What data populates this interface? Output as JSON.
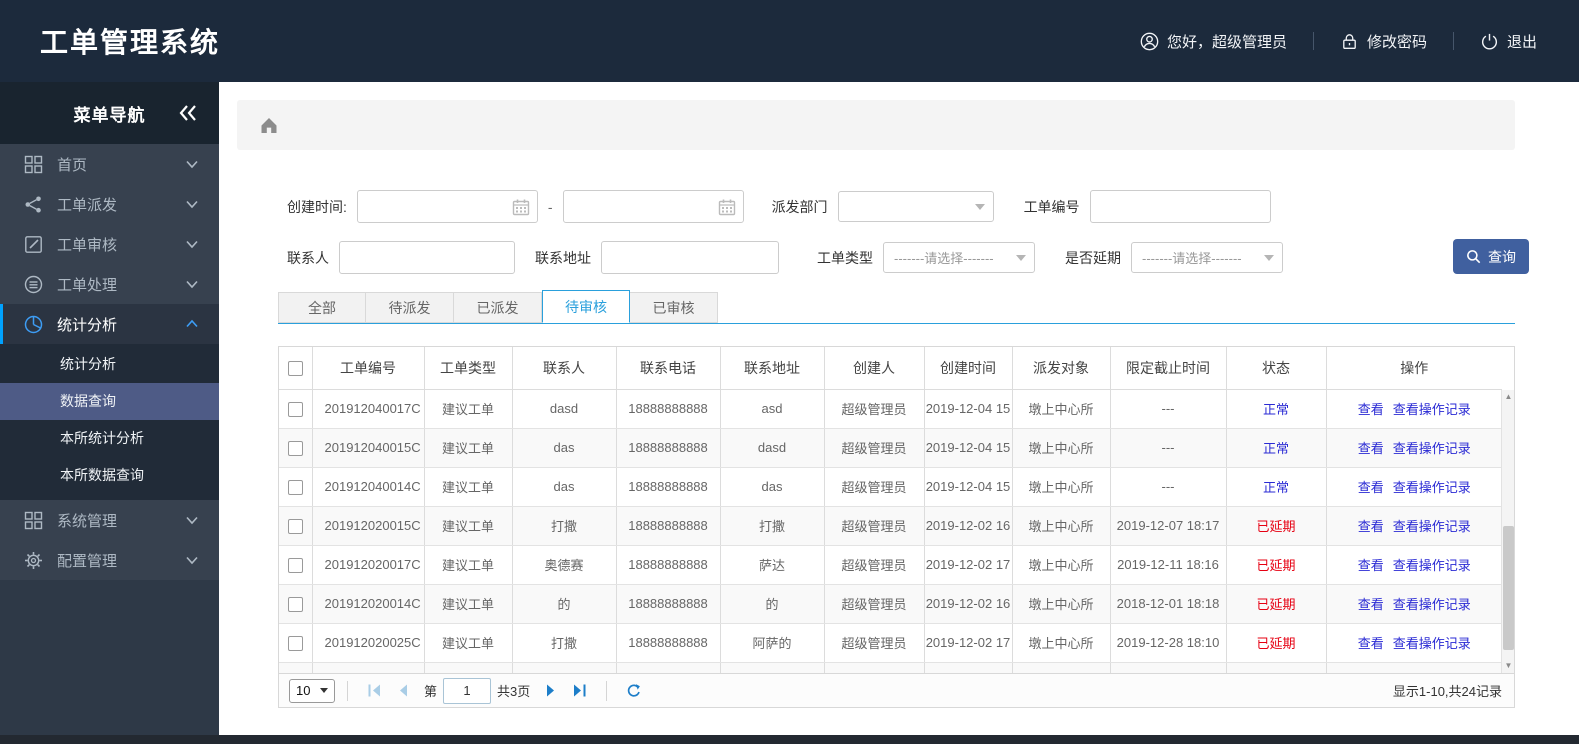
{
  "app": {
    "title": "工单管理系统"
  },
  "header": {
    "greeting": "您好，超级管理员",
    "change_password": "修改密码",
    "logout": "退出"
  },
  "sidebar": {
    "title": "菜单导航",
    "items": [
      {
        "label": "首页",
        "icon": "dashboard-icon"
      },
      {
        "label": "工单派发",
        "icon": "share-icon"
      },
      {
        "label": "工单审核",
        "icon": "edit-icon"
      },
      {
        "label": "工单处理",
        "icon": "database-icon"
      },
      {
        "label": "统计分析",
        "icon": "pie-chart-icon",
        "expanded": true
      },
      {
        "label": "系统管理",
        "icon": "grid-icon"
      },
      {
        "label": "配置管理",
        "icon": "gear-icon"
      }
    ],
    "subitems": [
      "统计分析",
      "数据查询",
      "本所统计分析",
      "本所数据查询"
    ],
    "selected_subitem": "数据查询"
  },
  "filters": {
    "created_time_label": "创建时间:",
    "date_separator": "-",
    "dispatch_dept_label": "派发部门",
    "order_no_label": "工单编号",
    "contact_label": "联系人",
    "address_label": "联系地址",
    "order_type_label": "工单类型",
    "order_type_placeholder": "-------请选择-------",
    "delay_label": "是否延期",
    "delay_placeholder": "-------请选择-------",
    "search_button": "查询"
  },
  "tabs": [
    {
      "label": "全部",
      "active": false
    },
    {
      "label": "待派发",
      "active": false
    },
    {
      "label": "已派发",
      "active": false
    },
    {
      "label": "待审核",
      "active": true
    },
    {
      "label": "已审核",
      "active": false
    }
  ],
  "table": {
    "columns": [
      "工单编号",
      "工单类型",
      "联系人",
      "联系电话",
      "联系地址",
      "创建人",
      "创建时间",
      "派发对象",
      "限定截止时间",
      "状态",
      "操作"
    ],
    "action_view": "查看",
    "action_log": "查看操作记录",
    "rows": [
      {
        "order_no": "201912040017C",
        "order_type": "建议工单",
        "contact": "dasd",
        "phone": "18888888888",
        "address": "asd",
        "creator": "超级管理员",
        "created": "2019-12-04 15",
        "target": "墩上中心所",
        "deadline": "---",
        "status": "正常",
        "status_type": "normal"
      },
      {
        "order_no": "201912040015C",
        "order_type": "建议工单",
        "contact": "das",
        "phone": "18888888888",
        "address": "dasd",
        "creator": "超级管理员",
        "created": "2019-12-04 15",
        "target": "墩上中心所",
        "deadline": "---",
        "status": "正常",
        "status_type": "normal"
      },
      {
        "order_no": "201912040014C",
        "order_type": "建议工单",
        "contact": "das",
        "phone": "18888888888",
        "address": "das",
        "creator": "超级管理员",
        "created": "2019-12-04 15",
        "target": "墩上中心所",
        "deadline": "---",
        "status": "正常",
        "status_type": "normal"
      },
      {
        "order_no": "201912020015C",
        "order_type": "建议工单",
        "contact": "打撒",
        "phone": "18888888888",
        "address": "打撒",
        "creator": "超级管理员",
        "created": "2019-12-02 16",
        "target": "墩上中心所",
        "deadline": "2019-12-07 18:17",
        "status": "已延期",
        "status_type": "delayed"
      },
      {
        "order_no": "201912020017C",
        "order_type": "建议工单",
        "contact": "奥德赛",
        "phone": "18888888888",
        "address": "萨达",
        "creator": "超级管理员",
        "created": "2019-12-02 17",
        "target": "墩上中心所",
        "deadline": "2019-12-11 18:16",
        "status": "已延期",
        "status_type": "delayed"
      },
      {
        "order_no": "201912020014C",
        "order_type": "建议工单",
        "contact": "的",
        "phone": "18888888888",
        "address": "的",
        "creator": "超级管理员",
        "created": "2019-12-02 16",
        "target": "墩上中心所",
        "deadline": "2018-12-01 18:18",
        "status": "已延期",
        "status_type": "delayed"
      },
      {
        "order_no": "201912020025C",
        "order_type": "建议工单",
        "contact": "打撒",
        "phone": "18888888888",
        "address": "阿萨的",
        "creator": "超级管理员",
        "created": "2019-12-02 17",
        "target": "墩上中心所",
        "deadline": "2019-12-28 18:10",
        "status": "已延期",
        "status_type": "delayed"
      }
    ]
  },
  "pagination": {
    "page_size": "10",
    "page_prefix": "第",
    "current_page": "1",
    "total_pages": "共3页",
    "summary": "显示1-10,共24记录"
  },
  "colors": {
    "topbar_bg": "#1c2a3c",
    "sidebar_bg": "#2e3947",
    "accent_blue": "#00a2ff",
    "tab_active": "#2aa0dc",
    "button_bg": "#40609f",
    "status_normal": "#2a2ad4",
    "status_delayed": "#e60012",
    "link_blue": "#2a2ad4"
  }
}
